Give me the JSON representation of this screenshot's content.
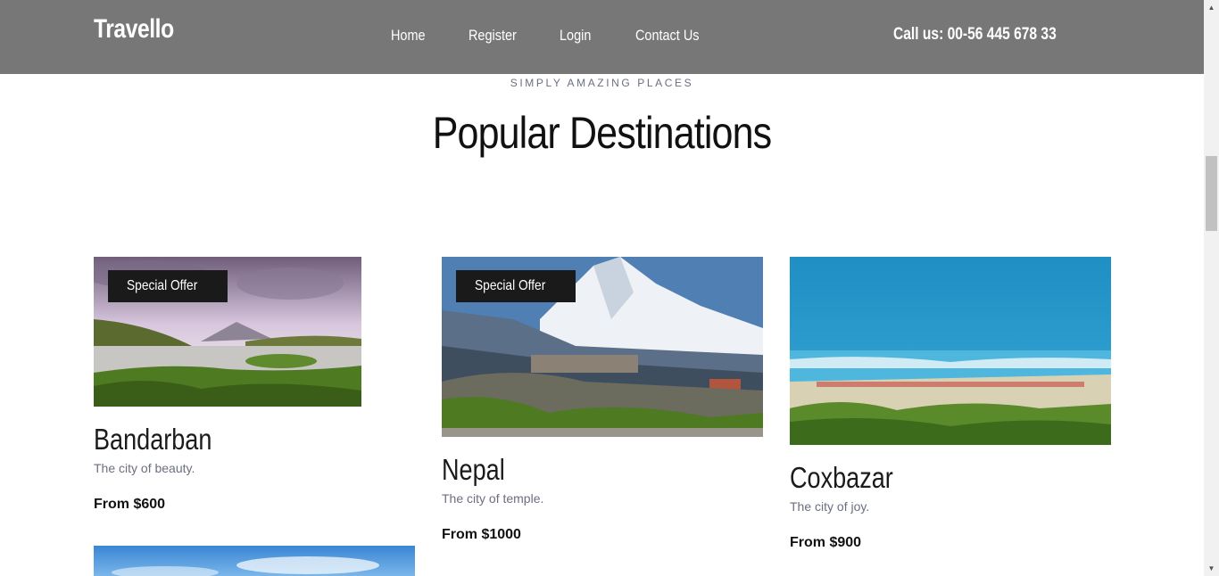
{
  "header": {
    "brand": "Travello",
    "nav": [
      "Home",
      "Register",
      "Login",
      "Contact Us"
    ],
    "phone": "Call us: 00-56 445 678 33"
  },
  "section": {
    "eyebrow": "SIMPLY AMAZING PLACES",
    "title": "Popular Destinations"
  },
  "destinations": [
    {
      "name": "Bandarban",
      "tagline": "The city of beauty.",
      "price": "From $600",
      "badge": "Special Offer"
    },
    {
      "name": "Nepal",
      "tagline": "The city of temple.",
      "price": "From $1000",
      "badge": "Special Offer"
    },
    {
      "name": "Coxbazar",
      "tagline": "The city of joy.",
      "price": "From $900"
    }
  ],
  "colors": {
    "header_bg": "#777777",
    "badge_bg": "#1a1a1a",
    "muted_text": "#6b6f80"
  }
}
